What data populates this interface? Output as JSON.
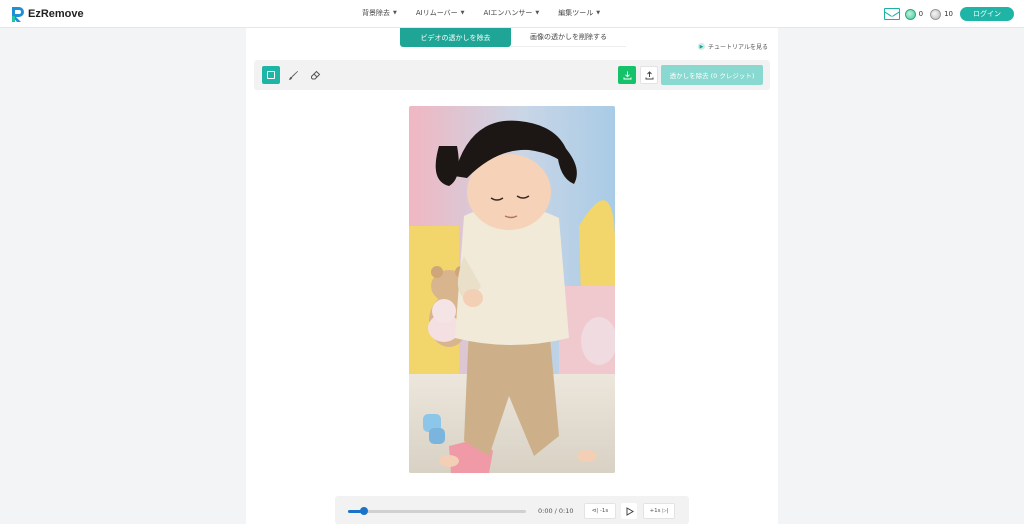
{
  "brand": {
    "name": "EzRemove",
    "accent": "#1fb5a6"
  },
  "nav": {
    "items": [
      {
        "label": "背景除去"
      },
      {
        "label": "AIリムーバー"
      },
      {
        "label": "AIエンハンサー"
      },
      {
        "label": "編集ツール"
      }
    ]
  },
  "header": {
    "mail_icon": "mail-icon",
    "credits_green": "0",
    "credits_grey": "10",
    "login_label": "ログイン"
  },
  "tabs": {
    "video_label": "ビデオの透かしを除去",
    "image_label": "画像の透かしを削除する"
  },
  "tutorial": {
    "label": "チュートリアルを見る"
  },
  "toolbar": {
    "tools": [
      "rectangle-select-icon",
      "brush-icon",
      "eraser-icon"
    ],
    "remove_button_label": "透かしを除去 (0 クレジット)"
  },
  "player": {
    "time_label": "0:00 / 0:10",
    "back_label": "-1s",
    "forward_label": "+1s",
    "progress": 0.09
  }
}
